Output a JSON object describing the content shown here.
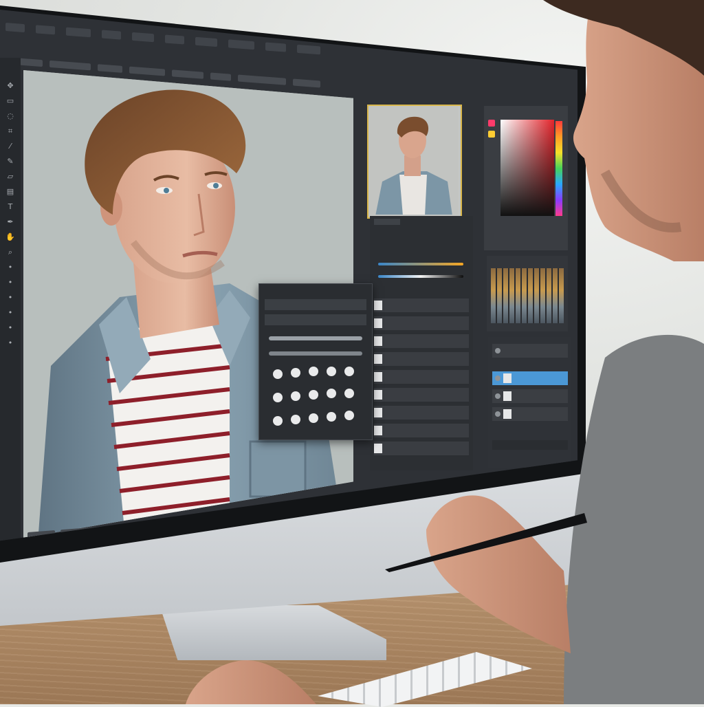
{
  "app": {
    "name": "photo editor",
    "menu": [
      "",
      "",
      "",
      "",
      "",
      "",
      "",
      "",
      "",
      ""
    ],
    "panels": {
      "brush_dialog": {
        "title": ""
      },
      "adjustments": {
        "title": ""
      },
      "layers": {
        "rows": [
          "",
          "",
          ""
        ]
      }
    }
  },
  "colors": {
    "accent": "#4b98d6",
    "thumb_border": "#d8b64a",
    "shirt_stripe": "#8e1f2a",
    "jacket": "#7c96a6"
  },
  "icons": [
    "move-icon",
    "marquee-icon",
    "lasso-icon",
    "crop-icon",
    "eyedropper-icon",
    "brush-icon",
    "eraser-icon",
    "gradient-icon",
    "type-icon",
    "pen-icon",
    "hand-icon",
    "zoom-icon"
  ]
}
